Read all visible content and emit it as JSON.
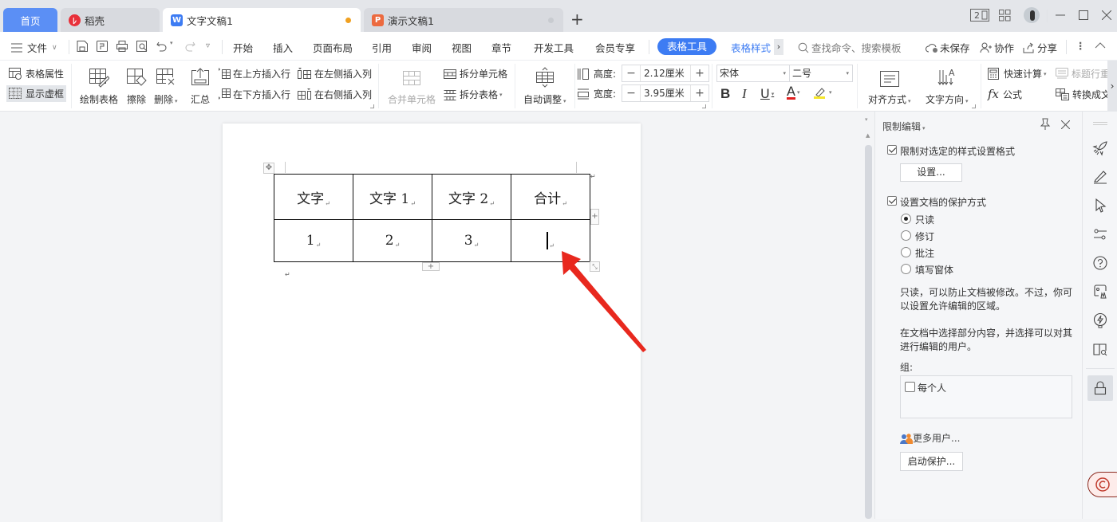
{
  "titlebar": {
    "tabs": [
      {
        "label": "首页",
        "icon": "home",
        "active": false
      },
      {
        "label": "稻壳",
        "icon": "daoke-logo-icon",
        "color": "#e8303a"
      },
      {
        "label": "文字文稿1",
        "icon": "writer-doc-icon",
        "color": "#3d7cf3",
        "unsaved_dot": "#f0a020",
        "active": true
      },
      {
        "label": "演示文稿1",
        "icon": "presentation-icon",
        "color": "#ec6a3f",
        "unsaved_dot": "#c8cbd0"
      }
    ],
    "add_tab": "+",
    "page_count_badge": "2",
    "window_controls": [
      "minimize",
      "maximize",
      "close"
    ]
  },
  "menubar": {
    "file_label": "文件",
    "quick_tools": [
      "save-icon",
      "export-pdf-icon",
      "print-icon",
      "print-preview-icon",
      "undo-icon",
      "redo-icon",
      "customize-icon"
    ],
    "menus": [
      "开始",
      "插入",
      "页面布局",
      "引用",
      "审阅",
      "视图",
      "章节",
      "开发工具",
      "会员专享"
    ],
    "active_context_tab": "表格工具",
    "context_tab_2": "表格样式",
    "more_tabs": "›",
    "search_placeholder": "查找命令、搜索模板",
    "unsaved_label": "未保存",
    "collab_label": "协作",
    "share_label": "分享",
    "accent_color": "#3d7cf3"
  },
  "ribbon": {
    "table_props": "表格属性",
    "show_gridlines": "显示虚框",
    "draw_table": "绘制表格",
    "erase": "擦除",
    "delete": "删除",
    "summary": "汇总",
    "insert_row_above": "在上方插入行",
    "insert_row_below": "在下方插入行",
    "insert_col_left": "在左侧插入列",
    "insert_col_right": "在右侧插入列",
    "merge_cells": "合并单元格",
    "split_cells": "拆分单元格",
    "split_table": "拆分表格",
    "auto_fit": "自动调整",
    "height_label": "高度:",
    "height_value": "2.12厘米",
    "width_label": "宽度:",
    "width_value": "3.95厘米",
    "font_name": "宋体",
    "font_size": "二号",
    "bold": "B",
    "italic": "I",
    "underline": "U",
    "font_color": "A",
    "font_color_hex": "#e02020",
    "highlight_hex": "#f5e62a",
    "align": "对齐方式",
    "text_direction": "文字方向",
    "quick_calc": "快速计算",
    "header_row_repeat": "标题行重",
    "formula": "公式",
    "convert": "转换成文"
  },
  "document": {
    "table": {
      "rows": [
        [
          "文字",
          "文字 1",
          "文字 2",
          "合计"
        ],
        [
          "1",
          "2",
          "3",
          ""
        ]
      ],
      "cursor_cell": [
        1,
        3
      ]
    },
    "annotation_arrow_color": "#e8281e"
  },
  "panel": {
    "title": "限制编辑",
    "restrict_format_label": "限制对选定的样式设置格式",
    "restrict_format_checked": true,
    "settings_button": "设置...",
    "protect_label": "设置文档的保护方式",
    "protect_checked": true,
    "modes": [
      {
        "label": "只读",
        "selected": true
      },
      {
        "label": "修订",
        "selected": false
      },
      {
        "label": "批注",
        "selected": false
      },
      {
        "label": "填写窗体",
        "selected": false
      }
    ],
    "desc1_line1": "只读，可以防止文档被修改。不过，你可",
    "desc1_line2": "以设置允许编辑的区域。",
    "desc2_line1": "在文档中选择部分内容，并选择可以对其",
    "desc2_line2": "进行编辑的用户。",
    "group_label": "组:",
    "everyone_label": "每个人",
    "everyone_checked": false,
    "more_users": "更多用户...",
    "start_protect_button": "启动保护..."
  },
  "sidebar": {
    "icons": [
      "rocket-icon",
      "pen-icon",
      "select-cursor-icon",
      "settings-sliders-icon",
      "help-icon",
      "ai-image-icon",
      "lightning-icon",
      "book-search-icon",
      "lock-icon"
    ],
    "active": "lock-icon"
  }
}
